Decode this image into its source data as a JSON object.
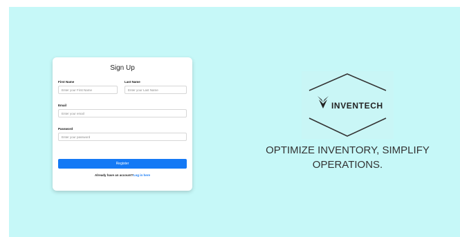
{
  "signup": {
    "title": "Sign Up",
    "first_name": {
      "label": "First Name",
      "placeholder": "Enter your First Name"
    },
    "last_name": {
      "label": "Last Name",
      "placeholder": "Enter your Last Name"
    },
    "email": {
      "label": "Email",
      "placeholder": "Enter your email"
    },
    "password": {
      "label": "Password",
      "placeholder": "Enter your password"
    },
    "register_label": "Register",
    "login_prompt": "Already have an account?",
    "login_link": "Log in here"
  },
  "brand": {
    "logo_text": "INVENTECH",
    "tagline_line1": "OPTIMIZE INVENTORY, SIMPLIFY",
    "tagline_line2": "OPERATIONS."
  },
  "colors": {
    "background": "#c6f8f8",
    "primary": "#1479f5",
    "card": "#ffffff"
  },
  "icons": {
    "logo_mark": "leaf-mark-icon"
  }
}
